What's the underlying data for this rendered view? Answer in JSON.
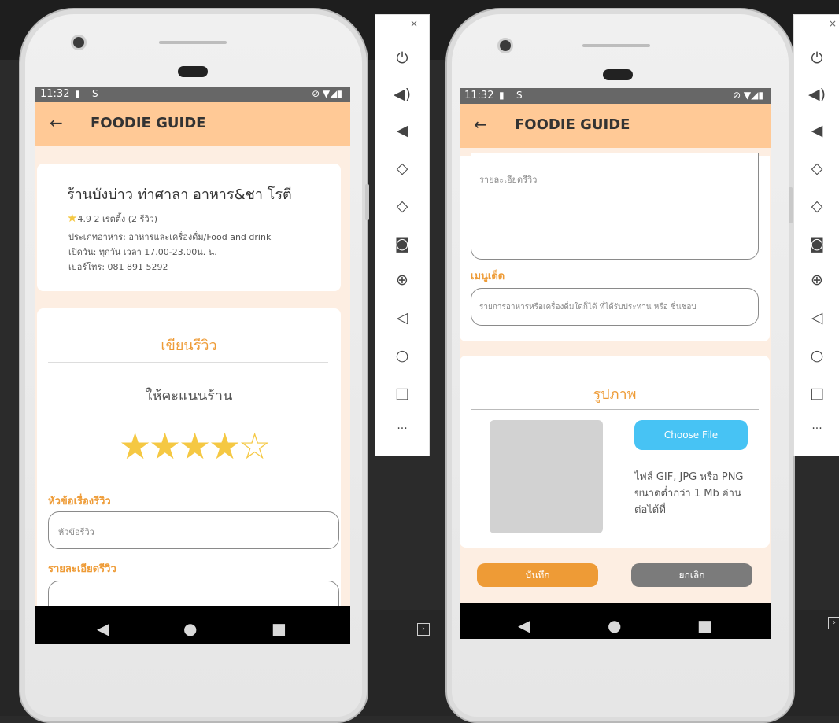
{
  "app": {
    "title": "FOODIE GUIDE",
    "back_icon": "arrow-left-icon"
  },
  "status": {
    "time": "11:32",
    "icons": "⊘ ▼◢▮"
  },
  "restaurant": {
    "name": "ร้านบังบ่าว ท่าศาลา อาหาร&ชา โรตี",
    "rating": "4.9 2 เรตติ้ง (2 รีวิว)",
    "type": "ประเภทอาหาร: อาหารและเครื่องดื่ม/Food and drink",
    "hours": "เปิดวัน: ทุกวัน เวลา 17.00-23.00น. น.",
    "phone": "เบอร์โทร: 081 891 5292"
  },
  "review": {
    "heading": "เขียนรีวิว",
    "rate_label": "ให้คะแนนร้าน",
    "rating": 4,
    "max_rating": 5,
    "title_label": "หัวข้อเรื่องรีวิว",
    "title_placeholder": "หัวข้อรีวิว",
    "detail_label": "รายละเอียดรีวิว",
    "detail_placeholder": "รายละเอียดรีวิว",
    "menu_label": "เมนูเด็ด",
    "menu_placeholder": "รายการอาหารหรือเครื่องดื่มใดก็ได้ ที่ได้รับประทาน หรือ ชื่นชอบ"
  },
  "photo": {
    "heading": "รูปภาพ",
    "choose_file": "Choose File",
    "hint": "ไฟล์ GIF, JPG หรือ PNG ขนาดต่ำกว่า 1 Mb อ่านต่อได้ที่"
  },
  "actions": {
    "save": "บันทึก",
    "cancel": "ยกเลิก"
  },
  "emulator": {
    "minimize": "–",
    "close": "×",
    "more": "···"
  },
  "colors": {
    "appbar": "#ffc996",
    "accent": "#ee9b36",
    "choose_file": "#47c3f4",
    "cancel": "#7b7b7b",
    "star": "#f5c843"
  }
}
